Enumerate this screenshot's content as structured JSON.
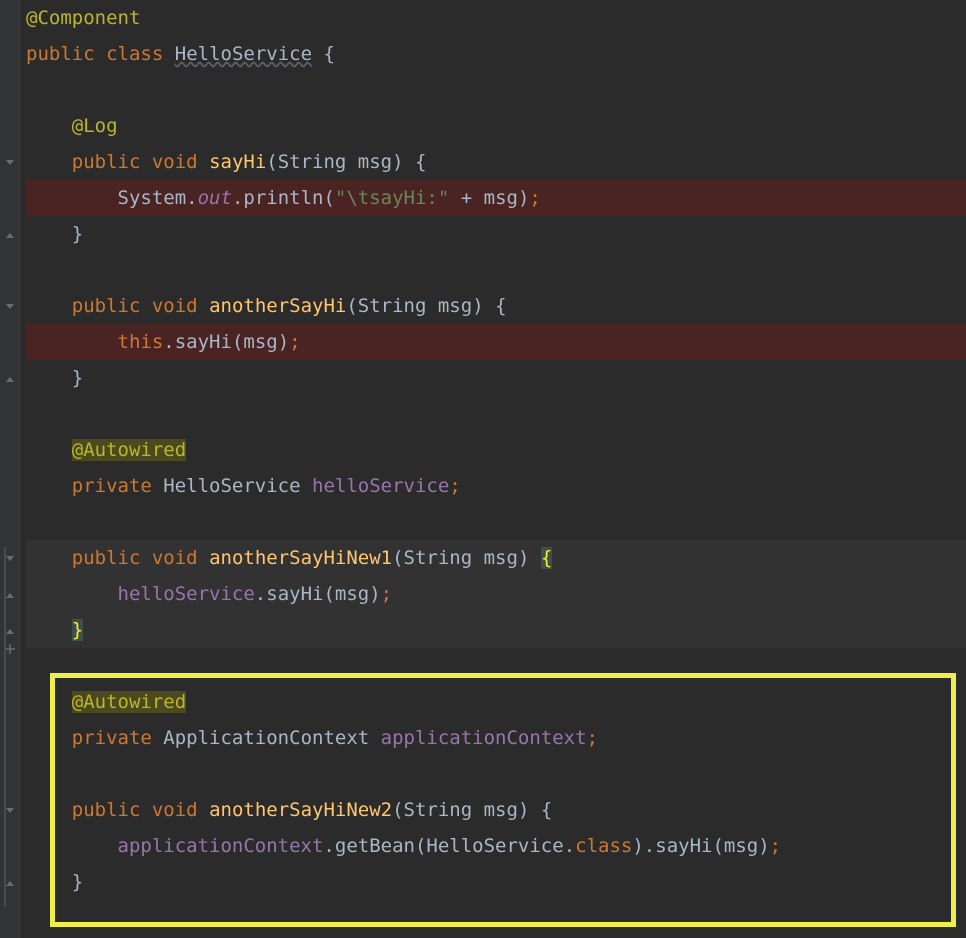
{
  "code": {
    "l1": {
      "annotation": "@Component"
    },
    "l2": {
      "kw1": "public",
      "kw2": "class",
      "name": "HelloService",
      "brace": "{"
    },
    "l3": "",
    "l4": {
      "annotation": "@Log"
    },
    "l5": {
      "kw1": "public",
      "kw2": "void",
      "method": "sayHi",
      "params": "(String msg) ",
      "brace": "{"
    },
    "l6": {
      "ind": "        ",
      "obj": "System",
      "dot1": ".",
      "field": "out",
      "dot2": ".",
      "call": "println",
      "paren1": "(",
      "str": "\"\\tsayHi:\"",
      "plus": " + ",
      "arg": "msg",
      "paren2": ")",
      "semi": ";"
    },
    "l7": {
      "brace": "}"
    },
    "l8": "",
    "l9": {
      "kw1": "public",
      "kw2": "void",
      "method": "anotherSayHi",
      "params": "(String msg) ",
      "brace": "{"
    },
    "l10": {
      "ind": "        ",
      "kw": "this",
      "dot": ".",
      "call": "sayHi",
      "args": "(msg)",
      "semi": ";"
    },
    "l11": {
      "brace": "}"
    },
    "l12": "",
    "l13": {
      "annotation": "@Autowired"
    },
    "l14": {
      "kw1": "private",
      "type": "HelloService",
      "name": "helloService",
      "semi": ";"
    },
    "l15": "",
    "l16": {
      "kw1": "public",
      "kw2": "void",
      "method": "anotherSayHiNew1",
      "params": "(String msg) ",
      "brace": "{"
    },
    "l17": {
      "ind": "        ",
      "field": "helloService",
      "dot": ".",
      "call": "sayHi",
      "args": "(msg)",
      "semi": ";"
    },
    "l18": {
      "brace": "}"
    },
    "l19": "",
    "l20": {
      "annotation": "@Autowired"
    },
    "l21": {
      "kw1": "private",
      "type": "ApplicationContext",
      "name": "applicationContext",
      "semi": ";"
    },
    "l22": "",
    "l23": {
      "kw1": "public",
      "kw2": "void",
      "method": "anotherSayHiNew2",
      "params": "(String msg) ",
      "brace": "{"
    },
    "l24": {
      "ind": "        ",
      "field": "applicationContext",
      "dot1": ".",
      "call1": "getBean",
      "paren1": "(",
      "arg1": "HelloService",
      "dot2": ".",
      "kw": "class",
      "paren2": ")",
      "dot3": ".",
      "call2": "sayHi",
      "args2": "(msg)",
      "semi": ";"
    },
    "l25": {
      "brace": "}"
    }
  },
  "colors": {
    "annotation": "#bbb529",
    "keyword": "#cc7832",
    "method": "#ffc66d",
    "field": "#9876aa",
    "string": "#6a8759",
    "default": "#a9b7c6",
    "background": "#2b2b2b",
    "highlightRed": "#4a2323",
    "highlightBox": "#f0ee4a"
  }
}
